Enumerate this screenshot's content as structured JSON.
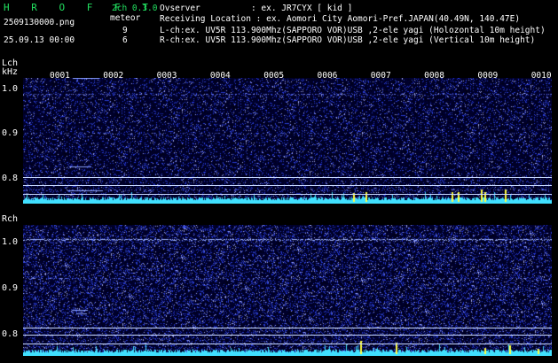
{
  "header": {
    "title": "H R O F F T",
    "version": "2ch 0.3.0",
    "filename": "2509130000.png",
    "event_type": "meteor",
    "lch_count": "9",
    "rch_count": "6",
    "datetime": "25.09.13 00:00",
    "observer": "Ovserver          : ex. JR7CYX [ kid ]",
    "location": "Receiving Location : ex. Aomori City Aomori-Pref.JAPAN(40.49N, 140.47E)",
    "lch_desc": "L-ch:ex. UV5R 113.900Mhz(SAPPORO VOR)USB ,2-ele yagi (Holozontal 10m height)",
    "rch_desc": "R-ch:ex. UV5R 113.900Mhz(SAPPORO VOR)USB ,2-ele yagi (Vertical 10m height)"
  },
  "lch": {
    "label": "Lch",
    "unit": "kHz",
    "ticks": [
      "1.0",
      "0.9",
      "0.8"
    ]
  },
  "rch": {
    "label": "Rch",
    "ticks": [
      "1.0",
      "0.9",
      "0.8"
    ]
  },
  "minutes": [
    "0001",
    "0002",
    "0003",
    "0004",
    "0005",
    "0006",
    "0007",
    "0008",
    "0009",
    "0010"
  ],
  "colors": {
    "background": "#000000",
    "spectrum_base": "#000040",
    "noise": "#3040c0",
    "baseline": "#40e0ff",
    "burst": "#ffff40",
    "title_green": "#22e060"
  }
}
